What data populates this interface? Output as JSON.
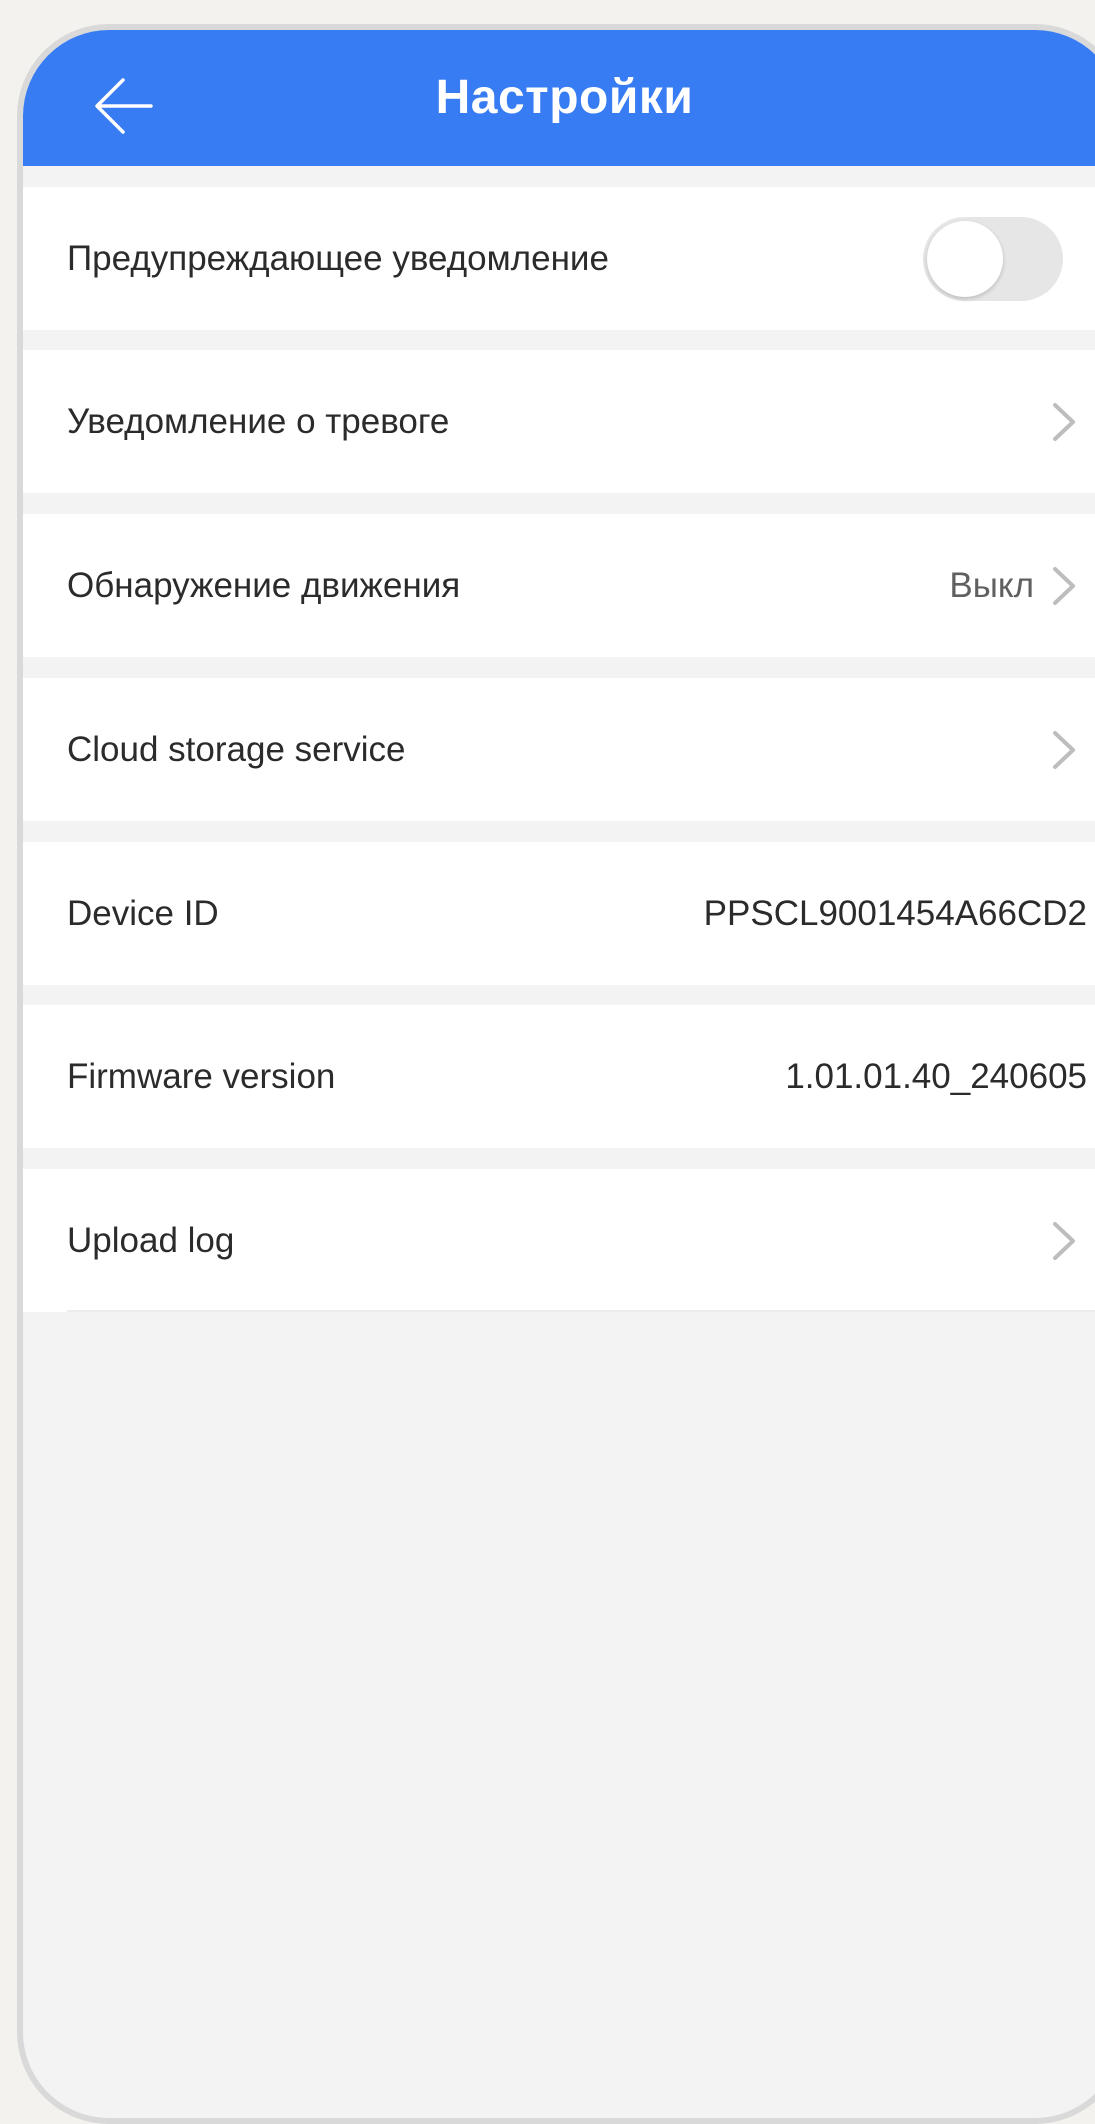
{
  "header": {
    "title": "Настройки",
    "back_icon": "arrow-left-icon",
    "color": "#377cf2"
  },
  "rows": [
    {
      "label": "Предупреждающее уведомление",
      "control": "toggle",
      "toggle_on": false
    },
    {
      "label": "Уведомление о тревоге",
      "control": "chevron"
    },
    {
      "label": "Обнаружение движения",
      "value": "Выкл",
      "control": "chevron"
    },
    {
      "label": "Cloud storage service",
      "control": "chevron"
    },
    {
      "label": "Device ID",
      "value": "PPSCL9001454A66CD2"
    },
    {
      "label": "Firmware version",
      "value": "1.01.01.40_240605"
    },
    {
      "label": "Upload log",
      "control": "chevron"
    }
  ],
  "colors": {
    "background": "#f3f3f3",
    "row": "#ffffff",
    "text": "#2b2b2b",
    "chevron": "#bdbdbd"
  }
}
